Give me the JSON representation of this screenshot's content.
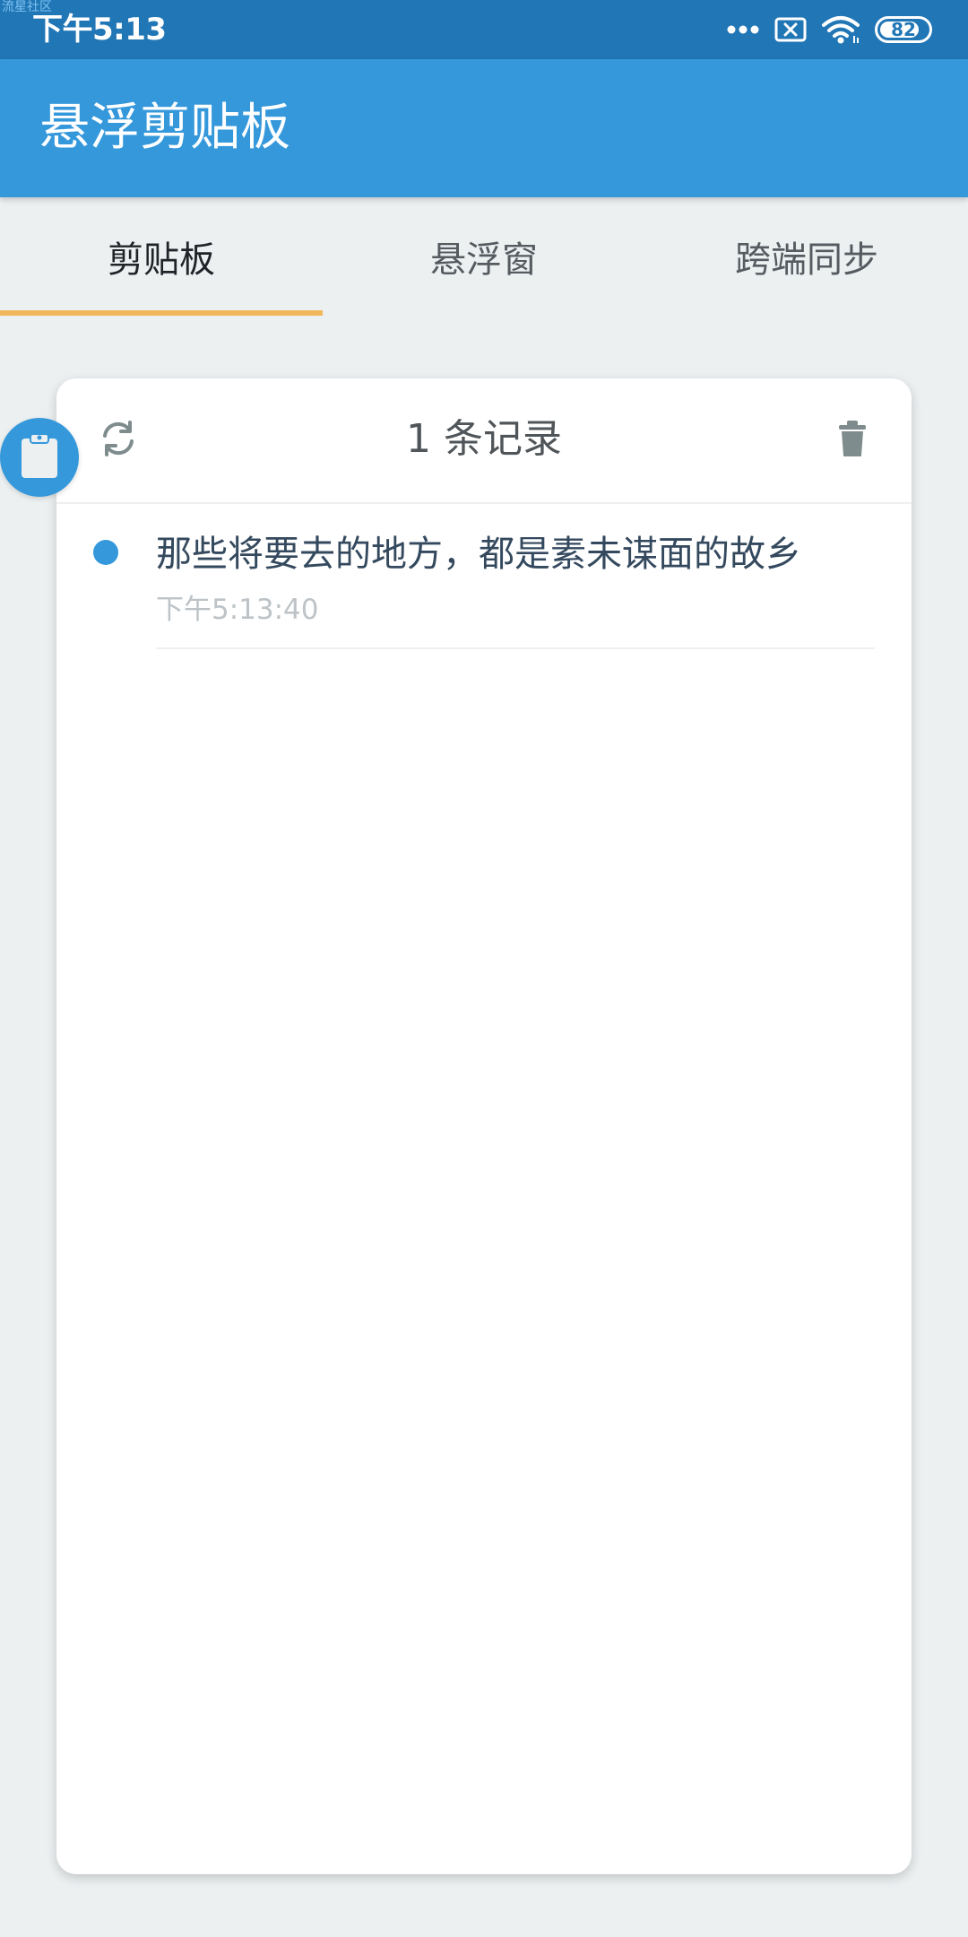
{
  "status_bar": {
    "watermark": "流星社区",
    "time": "下午5:13",
    "battery": "82",
    "battery_level": 0.82
  },
  "app_bar": {
    "title": "悬浮剪贴板"
  },
  "tabs": [
    {
      "label": "剪贴板",
      "active": true
    },
    {
      "label": "悬浮窗",
      "active": false
    },
    {
      "label": "跨端同步",
      "active": false
    }
  ],
  "card": {
    "record_count": "1 条记录",
    "items": [
      {
        "text": "那些将要去的地方，都是素未谋面的故乡",
        "time": "下午5:13:40"
      }
    ]
  },
  "colors": {
    "status_bar": "#2176B5",
    "app_bar": "#3498DB",
    "tab_indicator": "#F0B85A",
    "background": "#ECF0F1",
    "dot": "#3498DB"
  },
  "icons": {
    "refresh": "refresh-icon",
    "trash": "trash-icon",
    "clipboard": "clipboard-icon",
    "wifi": "wifi-icon",
    "sim": "no-sim-icon",
    "more": "more-dots-icon"
  }
}
